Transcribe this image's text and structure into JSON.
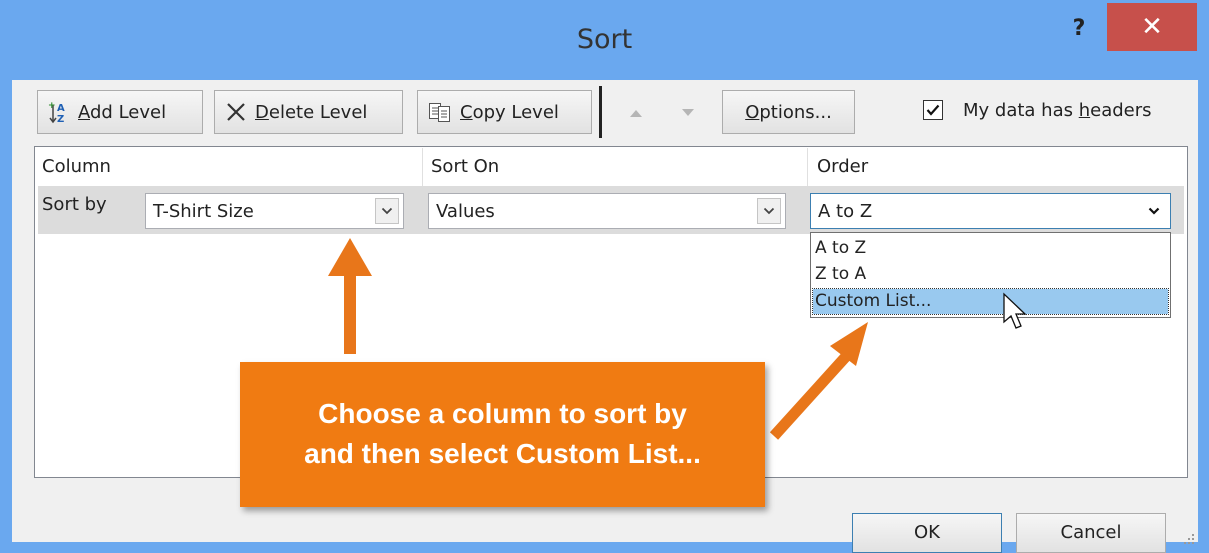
{
  "dialog": {
    "title": "Sort",
    "help_label": "?",
    "close_label": "✕"
  },
  "toolbar": {
    "add_level": {
      "pre": "",
      "key": "A",
      "post": "dd Level"
    },
    "delete_level": {
      "pre": "",
      "key": "D",
      "post": "elete Level"
    },
    "copy_level": {
      "pre": "",
      "key": "C",
      "post": "opy Level"
    },
    "options": {
      "pre": "",
      "key": "O",
      "post": "ptions..."
    },
    "headers_checkbox": {
      "pre": "My data has ",
      "key": "h",
      "post": "eaders",
      "checked": true
    }
  },
  "grid": {
    "columns": [
      "Column",
      "Sort On",
      "Order"
    ],
    "row": {
      "label": "Sort by",
      "column_value": "T-Shirt Size",
      "sort_on_value": "Values",
      "order_value": "A to Z"
    },
    "order_options": [
      "A to Z",
      "Z to A",
      "Custom List..."
    ],
    "highlighted_option": "Custom List..."
  },
  "buttons": {
    "ok": "OK",
    "cancel": "Cancel"
  },
  "callout": {
    "line1": "Choose a column to sort by",
    "line2": "and then select Custom List..."
  },
  "colors": {
    "title_bar": "#6aa8ef",
    "close_button": "#c7504b",
    "callout": "#f07b12",
    "highlight": "#99c9ef"
  }
}
